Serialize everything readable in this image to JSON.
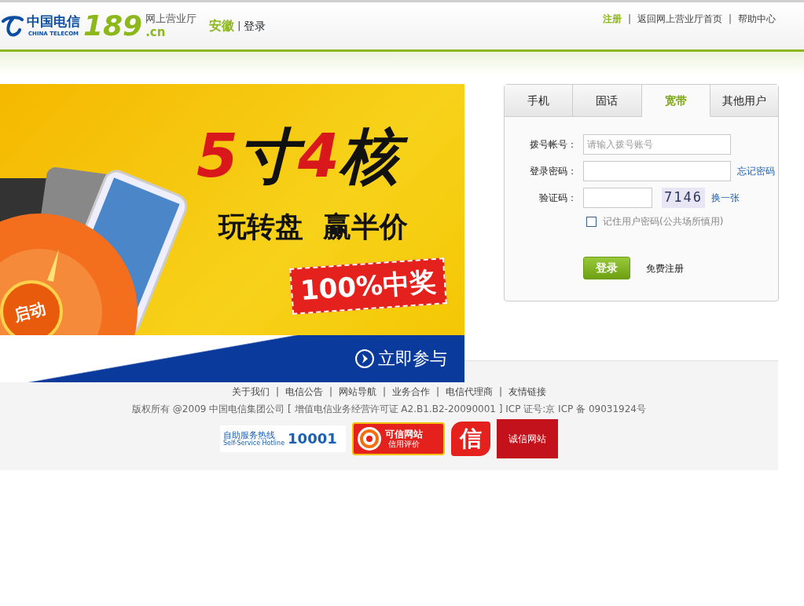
{
  "header": {
    "logo": {
      "name_cn": "中国电信",
      "name_en": "CHINA TELECOM",
      "number": "189",
      "domain": ".cn",
      "subtitle": "网上营业厅"
    },
    "region": "安徽",
    "region_separator": "|",
    "login_link": "登录",
    "nav_separator": "|",
    "nav_links": [
      {
        "label": "注册",
        "highlight": true
      },
      {
        "label": "返回网上营业厅首页",
        "highlight": false
      },
      {
        "label": "帮助中心",
        "highlight": false
      }
    ]
  },
  "banner": {
    "headline": [
      {
        "text": "5",
        "color": "#d9181c"
      },
      {
        "text": "寸",
        "color": "#111111"
      },
      {
        "text": "4",
        "color": "#d9181c"
      },
      {
        "text": "核",
        "color": "#111111"
      }
    ],
    "tagline": "玩转盘  赢半价",
    "stamp": "100%中奖",
    "wheel_button": "启动",
    "cta": "立即参与"
  },
  "login": {
    "tabs": [
      {
        "label": "手机",
        "selected": false
      },
      {
        "label": "固话",
        "selected": false
      },
      {
        "label": "宽带",
        "selected": true
      },
      {
        "label": "其他用户",
        "selected": false
      }
    ],
    "fields": [
      {
        "kind": "text",
        "label": "拨号帐号：",
        "placeholder": "请输入拨号账号"
      },
      {
        "kind": "password",
        "label": "登录密码：",
        "link": "忘记密码"
      },
      {
        "kind": "captcha",
        "label": "验证码：",
        "captcha": "7146",
        "link": "换一张"
      }
    ],
    "remember": {
      "label": "记住用户密码(公共场所慎用)",
      "checked": false
    },
    "submit": "登录",
    "register_link": "免费注册"
  },
  "footer": {
    "separator": "|",
    "links": [
      "关于我们",
      "电信公告",
      "网站导航",
      "业务合作",
      "电信代理商",
      "友情链接"
    ],
    "copyright": "版权所有 @2009 中国电信集团公司 [ 增值电信业务经营许可证 A2.B1.B2-20090001 ] ICP 证号:京 ICP 备 09031924号",
    "badges": [
      {
        "kind": "hotline",
        "title": "自助服务热线",
        "subtitle": "Self-Service Hotline",
        "number": "10001"
      },
      {
        "kind": "trusted",
        "title": "可信网站",
        "subtitle": "信用评价"
      },
      {
        "kind": "seal",
        "title": "信"
      },
      {
        "kind": "integrity",
        "title": "诚信网站"
      }
    ]
  }
}
